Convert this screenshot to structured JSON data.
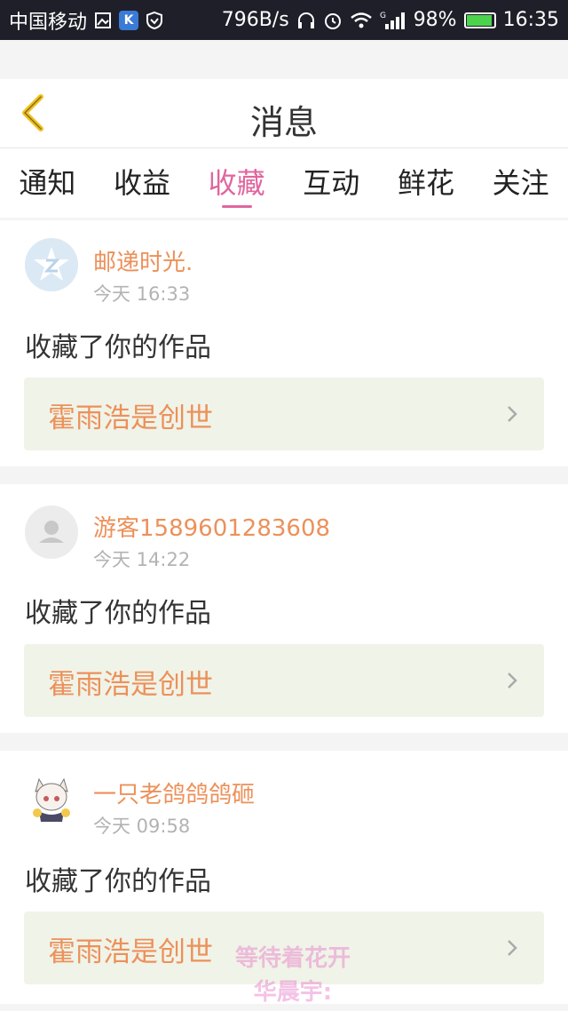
{
  "status_bar": {
    "carrier": "中国移动",
    "speed": "796B/s",
    "network": "G",
    "battery": "98%",
    "time": "16:35"
  },
  "header": {
    "title": "消息"
  },
  "tabs": [
    {
      "label": "通知"
    },
    {
      "label": "收益"
    },
    {
      "label": "收藏",
      "active": true
    },
    {
      "label": "互动"
    },
    {
      "label": "鲜花"
    },
    {
      "label": "关注"
    }
  ],
  "messages": [
    {
      "username": "邮递时光.",
      "time": "今天 16:33",
      "action": "收藏了你的作品",
      "work_title": "霍雨浩是创世",
      "avatar_icon": "qzone-avatar-icon"
    },
    {
      "username": "游客1589601283608",
      "time": "今天 14:22",
      "action": "收藏了你的作品",
      "work_title": "霍雨浩是创世",
      "avatar_icon": "default-user-avatar-icon"
    },
    {
      "username": "一只老鸽鸽鸽砸",
      "time": "今天 09:58",
      "action": "收藏了你的作品",
      "work_title": "霍雨浩是创世",
      "avatar_icon": "anime-girl-avatar"
    }
  ],
  "watermark": {
    "line1": "等待着花开",
    "line2": "华晨宇:"
  },
  "colors": {
    "accent": "#e0669e",
    "username": "#ec915a",
    "back_arrow": "#f2c21a"
  }
}
